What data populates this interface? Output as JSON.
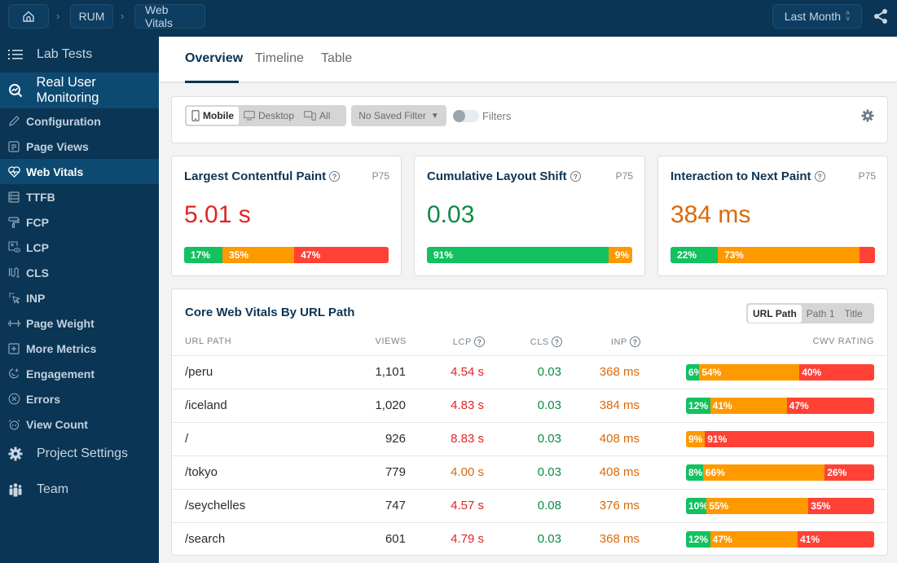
{
  "topbar": {
    "breadcrumbs": [
      {
        "label": "",
        "icon": "home-icon"
      },
      {
        "label": "RUM"
      },
      {
        "label": "Web Vitals"
      }
    ],
    "period": "Last Month",
    "share_icon": "share-icon"
  },
  "sidebar": {
    "lab_tests": "Lab Tests",
    "rum": "Real User Monitoring",
    "items": [
      {
        "label": "Configuration",
        "icon": "pencil-icon"
      },
      {
        "label": "Page Views",
        "icon": "document-icon"
      },
      {
        "label": "Web Vitals",
        "icon": "heartbeat-icon",
        "active": true
      },
      {
        "label": "TTFB",
        "icon": "server-icon"
      },
      {
        "label": "FCP",
        "icon": "paint-roller-icon"
      },
      {
        "label": "LCP",
        "icon": "image-view-icon"
      },
      {
        "label": "CLS",
        "icon": "layout-shift-icon"
      },
      {
        "label": "INP",
        "icon": "pointer-click-icon"
      },
      {
        "label": "Page Weight",
        "icon": "dumbbell-icon"
      },
      {
        "label": "More Metrics",
        "icon": "plus-square-icon"
      },
      {
        "label": "Engagement",
        "icon": "engagement-icon"
      },
      {
        "label": "Errors",
        "icon": "x-circle-icon"
      },
      {
        "label": "View Count",
        "icon": "alarm-icon"
      }
    ],
    "project_settings": "Project Settings",
    "team": "Team"
  },
  "tabs": [
    {
      "label": "Overview",
      "active": true
    },
    {
      "label": "Timeline"
    },
    {
      "label": "Table"
    }
  ],
  "filterbar": {
    "devices": [
      {
        "label": "Mobile",
        "active": true
      },
      {
        "label": "Desktop"
      },
      {
        "label": "All"
      }
    ],
    "saved_filter": "No Saved Filter",
    "filters_label": "Filters",
    "filters_enabled": false
  },
  "metrics": [
    {
      "title": "Largest Contentful Paint",
      "percentile": "P75",
      "value": "5.01 s",
      "rating": "poor",
      "distribution": [
        17,
        35,
        47
      ],
      "labels": [
        "17%",
        "35%",
        "47%"
      ]
    },
    {
      "title": "Cumulative Layout Shift",
      "percentile": "P75",
      "value": "0.03",
      "rating": "good",
      "distribution": [
        91,
        9,
        0
      ],
      "labels": [
        "91%",
        "9%",
        ""
      ]
    },
    {
      "title": "Interaction to Next Paint",
      "percentile": "P75",
      "value": "384 ms",
      "rating": "ni",
      "distribution": [
        22,
        73,
        5
      ],
      "labels": [
        "22%",
        "73%",
        ""
      ]
    }
  ],
  "table": {
    "title": "Core Web Vitals By URL Path",
    "grouping": [
      {
        "label": "URL Path",
        "active": true
      },
      {
        "label": "Path 1"
      },
      {
        "label": "Title"
      }
    ],
    "headers": {
      "path": "URL PATH",
      "views": "VIEWS",
      "lcp": "LCP",
      "cls": "CLS",
      "inp": "INP",
      "rating": "CWV RATING"
    },
    "rows": [
      {
        "path": "/peru",
        "views": "1,101",
        "lcp": "4.54 s",
        "lcp_rating": "poor",
        "cls": "0.03",
        "cls_rating": "good",
        "inp": "368 ms",
        "inp_rating": "ni",
        "distribution": [
          6,
          54,
          40
        ],
        "labels": [
          "6%",
          "54%",
          "40%"
        ]
      },
      {
        "path": "/iceland",
        "views": "1,020",
        "lcp": "4.83 s",
        "lcp_rating": "poor",
        "cls": "0.03",
        "cls_rating": "good",
        "inp": "384 ms",
        "inp_rating": "ni",
        "distribution": [
          12,
          41,
          47
        ],
        "labels": [
          "12%",
          "41%",
          "47%"
        ]
      },
      {
        "path": "/",
        "views": "926",
        "lcp": "8.83 s",
        "lcp_rating": "poor",
        "cls": "0.03",
        "cls_rating": "good",
        "inp": "408 ms",
        "inp_rating": "ni",
        "distribution": [
          0,
          9,
          91
        ],
        "labels": [
          "",
          "9%",
          "91%"
        ]
      },
      {
        "path": "/tokyo",
        "views": "779",
        "lcp": "4.00 s",
        "lcp_rating": "ni",
        "cls": "0.03",
        "cls_rating": "good",
        "inp": "408 ms",
        "inp_rating": "ni",
        "distribution": [
          8,
          66,
          26
        ],
        "labels": [
          "8%",
          "66%",
          "26%"
        ]
      },
      {
        "path": "/seychelles",
        "views": "747",
        "lcp": "4.57 s",
        "lcp_rating": "poor",
        "cls": "0.08",
        "cls_rating": "good",
        "inp": "376 ms",
        "inp_rating": "ni",
        "distribution": [
          10,
          55,
          35
        ],
        "labels": [
          "10%",
          "55%",
          "35%"
        ]
      },
      {
        "path": "/search",
        "views": "601",
        "lcp": "4.79 s",
        "lcp_rating": "poor",
        "cls": "0.03",
        "cls_rating": "good",
        "inp": "368 ms",
        "inp_rating": "ni",
        "distribution": [
          12,
          47,
          41
        ],
        "labels": [
          "12%",
          "47%",
          "41%"
        ]
      }
    ]
  },
  "colors": {
    "navy": "#0a3554",
    "good": "#12c160",
    "needs_improvement": "#ff9900",
    "poor": "#ff4136",
    "good_text": "#0c8a43",
    "ni_text": "#d9690b",
    "poor_text": "#e02424"
  }
}
